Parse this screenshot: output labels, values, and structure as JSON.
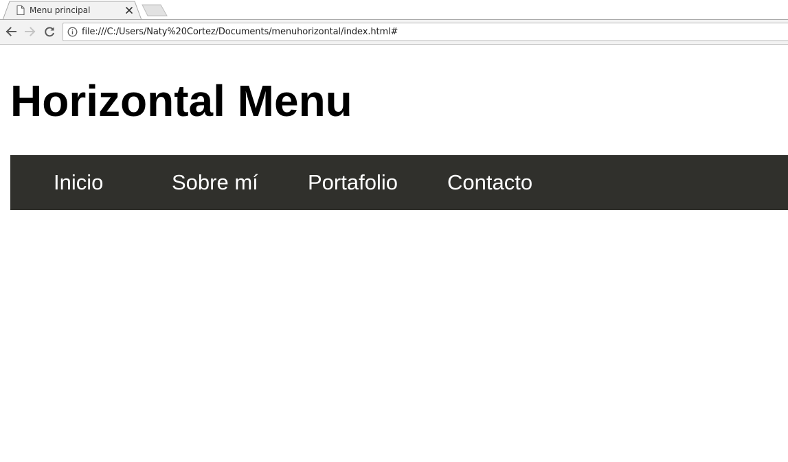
{
  "browser": {
    "tab": {
      "title": "Menu principal",
      "favicon": "page-icon",
      "close": "close-icon"
    },
    "new_tab": "new-tab-icon",
    "address_bar": {
      "url": "file:///C:/Users/Naty%20Cortez/Documents/menuhorizontal/index.html#",
      "security_icon": "info-icon"
    },
    "nav": {
      "back": "back-arrow-icon",
      "forward": "forward-arrow-icon",
      "reload": "reload-icon"
    }
  },
  "page": {
    "title": "Horizontal Menu",
    "menu": {
      "background": "#30302c",
      "text_color": "#ffffff",
      "items": [
        {
          "label": "Inicio"
        },
        {
          "label": "Sobre mí"
        },
        {
          "label": "Portafolio"
        },
        {
          "label": "Contacto"
        }
      ]
    }
  }
}
